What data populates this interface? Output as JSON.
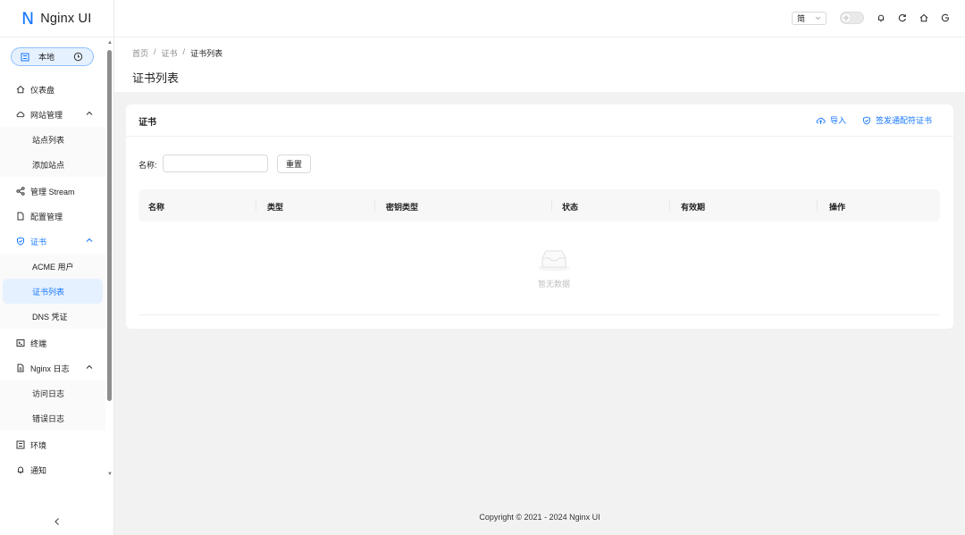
{
  "app": {
    "logo_letter": "N",
    "name": "Nginx UI"
  },
  "sidebar": {
    "environment": {
      "label": "本地"
    },
    "items": [
      {
        "label": "仪表盘"
      },
      {
        "label": "网站管理",
        "sub": [
          {
            "label": "站点列表"
          },
          {
            "label": "添加站点"
          }
        ]
      },
      {
        "label": "管理 Stream"
      },
      {
        "label": "配置管理"
      },
      {
        "label": "证书",
        "sub": [
          {
            "label": "ACME 用户"
          },
          {
            "label": "证书列表"
          },
          {
            "label": "DNS 凭证"
          }
        ]
      },
      {
        "label": "终端"
      },
      {
        "label": "Nginx 日志",
        "sub": [
          {
            "label": "访问日志"
          },
          {
            "label": "错误日志"
          }
        ]
      },
      {
        "label": "环境"
      },
      {
        "label": "通知"
      }
    ]
  },
  "header": {
    "language": "简"
  },
  "breadcrumb": {
    "home": "首页",
    "sep": "/",
    "section": "证书",
    "current": "证书列表"
  },
  "page": {
    "title": "证书列表"
  },
  "card": {
    "title": "证书",
    "import_label": "导入",
    "issue_wildcard_label": "签发通配符证书",
    "filter_label": "名称:",
    "filter_value": "",
    "reset_label": "重置",
    "columns": [
      "名称",
      "类型",
      "密钥类型",
      "状态",
      "有效期",
      "操作"
    ],
    "rows": [],
    "empty_text": "暂无数据"
  },
  "footer": {
    "copyright": "Copyright © 2021 - 2024 Nginx UI"
  },
  "colors": {
    "accent": "#1677ff",
    "accent_bg": "#e6f1ff"
  }
}
